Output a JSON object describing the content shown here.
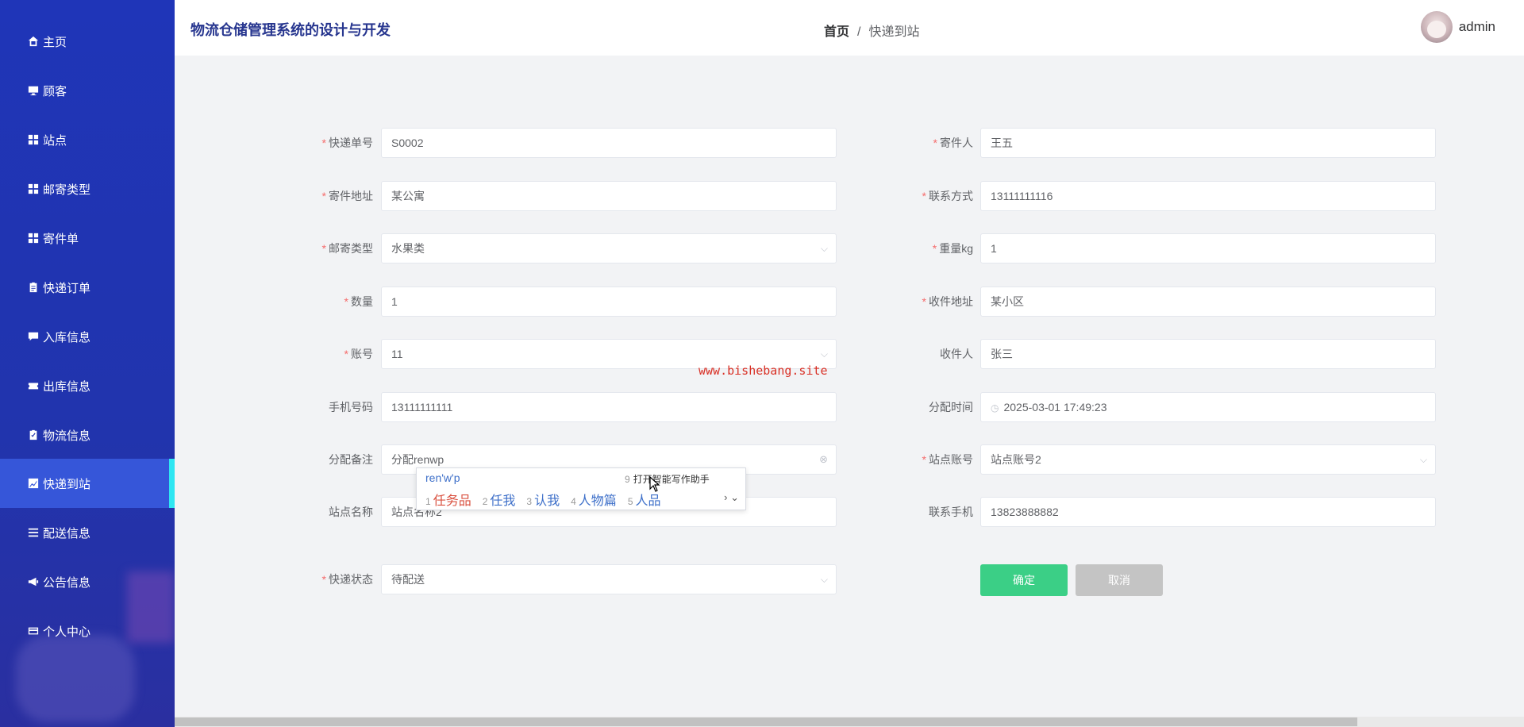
{
  "app": {
    "title": "物流仓储管理系统的设计与开发"
  },
  "breadcrumb": {
    "home": "首页",
    "separator": "/",
    "current": "快递到站"
  },
  "user": {
    "name": "admin"
  },
  "sidebar": {
    "items": [
      {
        "label": "主页",
        "icon": "home-icon"
      },
      {
        "label": "顾客",
        "icon": "monitor-icon"
      },
      {
        "label": "站点",
        "icon": "grid-icon"
      },
      {
        "label": "邮寄类型",
        "icon": "grid-icon"
      },
      {
        "label": "寄件单",
        "icon": "grid-icon"
      },
      {
        "label": "快递订单",
        "icon": "clipboard-icon"
      },
      {
        "label": "入库信息",
        "icon": "chat-icon"
      },
      {
        "label": "出库信息",
        "icon": "ticket-icon"
      },
      {
        "label": "物流信息",
        "icon": "checklist-icon"
      },
      {
        "label": "快递到站",
        "icon": "chart-icon",
        "active": true
      },
      {
        "label": "配送信息",
        "icon": "list-icon"
      },
      {
        "label": "公告信息",
        "icon": "megaphone-icon"
      },
      {
        "label": "个人中心",
        "icon": "card-icon"
      }
    ]
  },
  "form": {
    "tracking_no": {
      "label": "快递单号",
      "value": "S0002",
      "required": true
    },
    "sender": {
      "label": "寄件人",
      "value": "王五",
      "required": true
    },
    "sender_address": {
      "label": "寄件地址",
      "value": "某公寓",
      "required": true
    },
    "contact": {
      "label": "联系方式",
      "value": "13111111116",
      "required": true
    },
    "mail_type": {
      "label": "邮寄类型",
      "value": "水果类",
      "required": true
    },
    "weight": {
      "label": "重量kg",
      "value": "1",
      "required": true
    },
    "quantity": {
      "label": "数量",
      "value": "1",
      "required": true
    },
    "receiver_address": {
      "label": "收件地址",
      "value": "某小区",
      "required": true
    },
    "account": {
      "label": "账号",
      "value": "11",
      "required": true
    },
    "receiver": {
      "label": "收件人",
      "value": "张三",
      "required": false
    },
    "phone": {
      "label": "手机号码",
      "value": "13111111111",
      "required": false
    },
    "assign_time": {
      "label": "分配时间",
      "value": "2025-03-01 17:49:23",
      "required": false
    },
    "assign_note": {
      "label": "分配备注",
      "value": "分配renwp",
      "required": false
    },
    "station_account": {
      "label": "站点账号",
      "value": "站点账号2",
      "required": true
    },
    "station_name": {
      "label": "站点名称",
      "value": "站点名称2",
      "required": false
    },
    "station_phone": {
      "label": "联系手机",
      "value": "13823888882",
      "required": false
    },
    "status": {
      "label": "快递状态",
      "value": "待配送",
      "required": true
    }
  },
  "buttons": {
    "confirm": "确定",
    "cancel": "取消"
  },
  "watermark": "www.bishebang.site",
  "ime": {
    "composition": "ren'w'p",
    "hint_num": "9",
    "hint": "打开智能写作助手",
    "candidates": [
      {
        "n": "1",
        "text": "任务品"
      },
      {
        "n": "2",
        "text": "任我"
      },
      {
        "n": "3",
        "text": "认我"
      },
      {
        "n": "4",
        "text": "人物篇"
      },
      {
        "n": "5",
        "text": "人品"
      }
    ]
  },
  "colors": {
    "sidebar": "#1f35b8",
    "active": "#3656d9",
    "accent": "#2ee6f2",
    "confirm": "#3bcf86",
    "required": "#f56c6c"
  }
}
